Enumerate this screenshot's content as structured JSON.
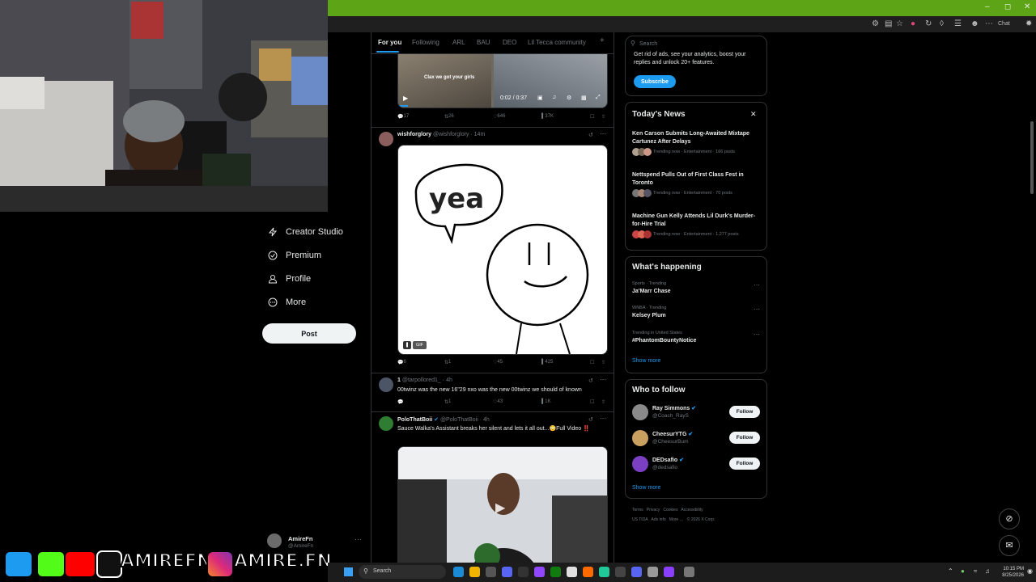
{
  "browser": {
    "title_bar_color": "#5da417",
    "toolbar_chat_label": "Chat"
  },
  "sidebar": {
    "items": [
      {
        "label": "Creator Studio",
        "icon": "bolt-icon"
      },
      {
        "label": "Premium",
        "icon": "verified-icon"
      },
      {
        "label": "Profile",
        "icon": "person-icon"
      },
      {
        "label": "More",
        "icon": "more-circle-icon"
      }
    ],
    "post_label": "Post",
    "account": {
      "name": "AmireFn",
      "handle": "@AmireFn"
    }
  },
  "feed": {
    "tabs": [
      "For you",
      "Following",
      "ARL",
      "BAU",
      "DEO",
      "Lil Tecca community"
    ],
    "video_top": {
      "caption": "Clax we got your girls",
      "time": "0:02 / 0:37",
      "replies": "17",
      "reposts": "26",
      "likes": "646",
      "views": "37K"
    },
    "tweet1": {
      "name": "wishforglory",
      "handle": "@wishforglory",
      "time": "14m",
      "gif_text": "yea",
      "gif_badge": "GIF",
      "replies": "6",
      "reposts": "1",
      "likes": "45",
      "views": "425"
    },
    "tweet2": {
      "name": "1",
      "handle": "@tarpollored1_",
      "time": "4h",
      "text": "00twinz was the new 16\"29 nxo was the new 00twinz we should of known",
      "replies": "",
      "reposts": "1",
      "likes": "43",
      "views": "1K"
    },
    "tweet3": {
      "name": "PoloThatBoii",
      "handle": "@PoloThatBoii",
      "time": "4h",
      "text": "Sauce Walka's Assistant breaks her silent and lets it all out...😳Full Video ‼️"
    }
  },
  "right": {
    "search_placeholder": "Search",
    "premium": {
      "text": "Get rid of ads, see your analytics, boost your replies and unlock 20+ features.",
      "button": "Subscribe"
    },
    "news": {
      "title": "Today's News",
      "items": [
        {
          "title": "Ken Carson Submits Long-Awaited Mixtape Cartunez After Delays",
          "meta": "Trending now · Entertainment · 166 posts"
        },
        {
          "title": "Nettspend Pulls Out of First Class Fest in Toronto",
          "meta": "Trending now · Entertainment · 70 posts"
        },
        {
          "title": "Machine Gun Kelly Attends Lil Durk's Murder-for-Hire Trial",
          "meta": "Trending now · Entertainment · 1,277 posts"
        }
      ]
    },
    "happening": {
      "title": "What's happening",
      "items": [
        {
          "category": "Sports · Trending",
          "name": "Ja'Marr Chase"
        },
        {
          "category": "WNBA · Trending",
          "name": "Kelsey Plum"
        },
        {
          "category": "Trending in United States",
          "name": "#PhantomBountyNotice"
        }
      ],
      "show_more": "Show more"
    },
    "follow": {
      "title": "Who to follow",
      "items": [
        {
          "name": "Ray Simmons",
          "handle": "@Coach_RayS",
          "button": "Follow"
        },
        {
          "name": "CheesurYTG",
          "handle": "@CheesurBum",
          "button": "Follow"
        },
        {
          "name": "DEDsafio",
          "handle": "@dedsafio",
          "button": "Follow"
        }
      ],
      "show_more": "Show more"
    },
    "footer": {
      "line1": [
        "Terms",
        "Privacy",
        "Cookies",
        "Accessibility"
      ],
      "line2": [
        "US TIDA",
        "Ads info",
        "More …",
        "© 2026 X Corp."
      ]
    }
  },
  "overlay": {
    "text1": "AMIREFN",
    "text2": "AMIRE.FN"
  },
  "taskbar": {
    "search_placeholder": "Search",
    "time": "10:15 PM",
    "date": "8/25/2026"
  }
}
